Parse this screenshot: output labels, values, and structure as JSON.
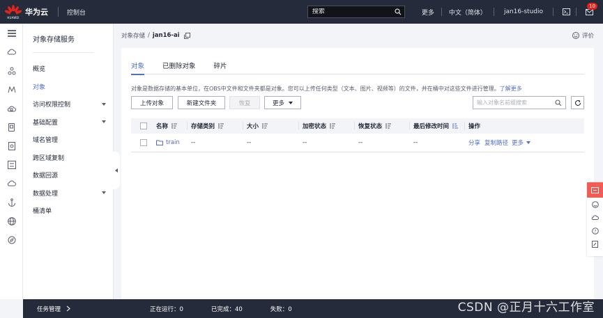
{
  "topbar": {
    "logo_text": "HUAWEI",
    "brand": "华为云",
    "console": "控制台",
    "search_placeholder": "搜索",
    "more": "更多",
    "language": "中文（简体）",
    "user": "jan16-studio",
    "message_count": "10"
  },
  "sidebar": {
    "title": "对象存储服务",
    "items": [
      {
        "label": "概览",
        "caret": false,
        "active": false
      },
      {
        "label": "对象",
        "caret": false,
        "active": true
      },
      {
        "label": "访问权限控制",
        "caret": true,
        "active": false
      },
      {
        "label": "基础配置",
        "caret": true,
        "active": false
      },
      {
        "label": "域名管理",
        "caret": false,
        "active": false
      },
      {
        "label": "跨区域复制",
        "caret": false,
        "active": false
      },
      {
        "label": "数据回源",
        "caret": false,
        "active": false
      },
      {
        "label": "数据处理",
        "caret": true,
        "active": false
      },
      {
        "label": "桶清单",
        "caret": false,
        "active": false
      }
    ]
  },
  "breadcrumb": {
    "root": "对象存储",
    "separator": "/",
    "current": "jan16-ai"
  },
  "review": "评价",
  "tabs": [
    {
      "label": "对象",
      "active": true
    },
    {
      "label": "已删除对象",
      "active": false
    },
    {
      "label": "碎片",
      "active": false
    }
  ],
  "description": {
    "text": "对象是数据存储的基本单位，在OBS中文件和文件夹都是对象。您可以上传任何类型（文本、图片、视频等）的文件，并在桶中对这些文件进行管理。",
    "link": "了解更多"
  },
  "toolbar": {
    "upload": "上传对象",
    "new_folder": "新建文件夹",
    "restore": "恢复",
    "more": "更多",
    "search_placeholder": "输入对象名前缀搜索"
  },
  "table": {
    "headers": [
      "名称",
      "存储类别",
      "大小",
      "加密状态",
      "恢复状态",
      "最后修改时间",
      "操作"
    ],
    "rows": [
      {
        "name": "train",
        "storage_class": "--",
        "size": "--",
        "encryption": "--",
        "restore": "--",
        "modified": "--",
        "actions": [
          "分享",
          "复制路径",
          "更多"
        ]
      }
    ]
  },
  "taskbar": {
    "title": "任务管理",
    "running_label": "正在运行：",
    "running": "0",
    "done_label": "已完成：",
    "done": "40",
    "failed_label": "失败：",
    "failed": "0"
  },
  "watermark": "CSDN @正月十六工作室",
  "colors": {
    "topbar": "#252b3a",
    "accent": "#526ecc",
    "brand_red": "#e2231a",
    "float_red": "#f25c54"
  }
}
